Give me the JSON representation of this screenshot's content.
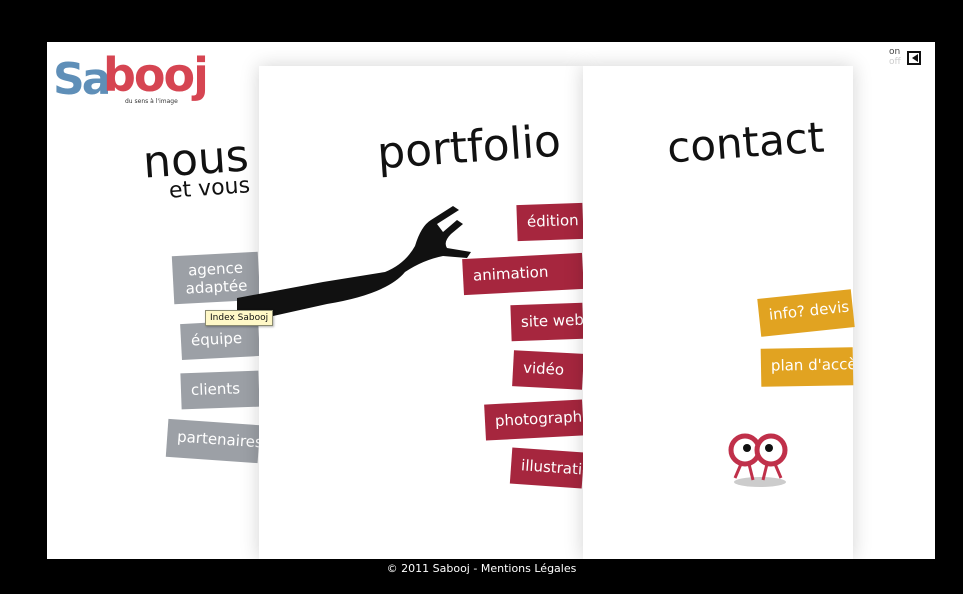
{
  "logo": {
    "part1": "Sa",
    "part2": "booj",
    "tagline": "du sens à l'image"
  },
  "sound": {
    "on_label": "on",
    "off_label": "off",
    "icon": "speaker-icon"
  },
  "nous": {
    "title": "nous",
    "subtitle": "et vous",
    "items": [
      "agence adaptée",
      "équipe",
      "clients",
      "partenaires"
    ]
  },
  "portfolio": {
    "title": "portfolio",
    "items": [
      "édition",
      "animation",
      "site web",
      "vidéo",
      "photographie",
      "illustration"
    ]
  },
  "contact": {
    "title": "contact",
    "items": [
      "info? devis",
      "plan d'accès"
    ],
    "mascot": "eyes-mascot-icon"
  },
  "tooltip": "Index Sabooj",
  "footer": {
    "copyright": "© 2011 Sabooj",
    "separator": "-",
    "legal": "Mentions Légales"
  },
  "colors": {
    "nous": "#9ca0a6",
    "portfolio": "#a6263e",
    "contact": "#e1a321",
    "logo_blue": "#5f8fb8",
    "logo_red": "#d64552"
  }
}
